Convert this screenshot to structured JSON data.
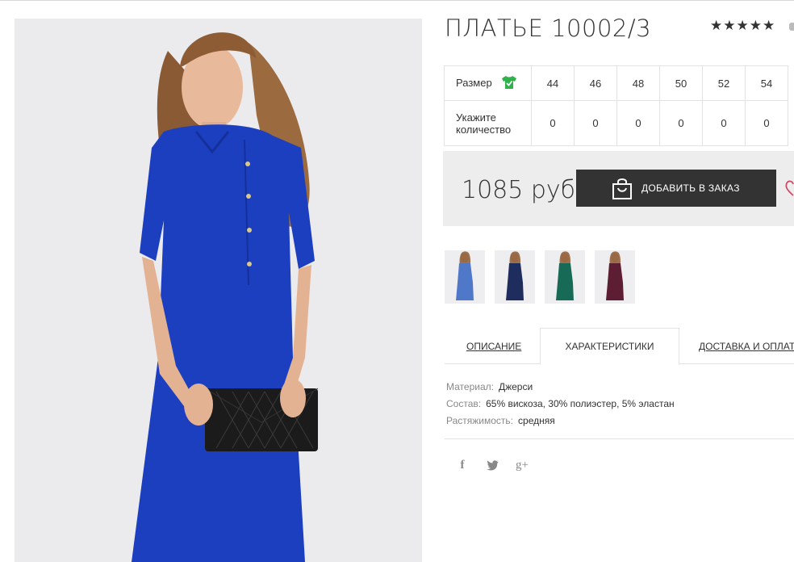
{
  "product": {
    "title": "ПЛАТЬЕ 10002/3",
    "rating_stars": "★★★★★",
    "price": "1085 руб",
    "order_button": "ДОБАВИТЬ В ЗАКАЗ"
  },
  "size_table": {
    "size_label": "Размер",
    "qty_label": "Укажите количество",
    "sizes": [
      "44",
      "46",
      "48",
      "50",
      "52",
      "54"
    ],
    "quantities": [
      "0",
      "0",
      "0",
      "0",
      "0",
      "0"
    ]
  },
  "thumbnails": [
    {
      "color": "#4f78c8"
    },
    {
      "color": "#1f2d5e"
    },
    {
      "color": "#176b56"
    },
    {
      "color": "#5d1d33"
    }
  ],
  "tabs": {
    "description": "ОПИСАНИЕ",
    "characteristics": "ХАРАКТЕРИСТИКИ",
    "delivery": "ДОСТАВКА И ОПЛАТА"
  },
  "specs": [
    {
      "key": "Материал:",
      "value": "Джерси"
    },
    {
      "key": "Состав:",
      "value": "65% вискоза, 30% полиэстер, 5% эластан"
    },
    {
      "key": "Растяжимость:",
      "value": "средняя"
    }
  ],
  "social": {
    "facebook": "f",
    "twitter": "t",
    "google": "g+"
  },
  "colors": {
    "dress": "#1c3fc0",
    "button": "#333333",
    "price_bg": "#ededed",
    "check_green": "#2fb24a"
  }
}
